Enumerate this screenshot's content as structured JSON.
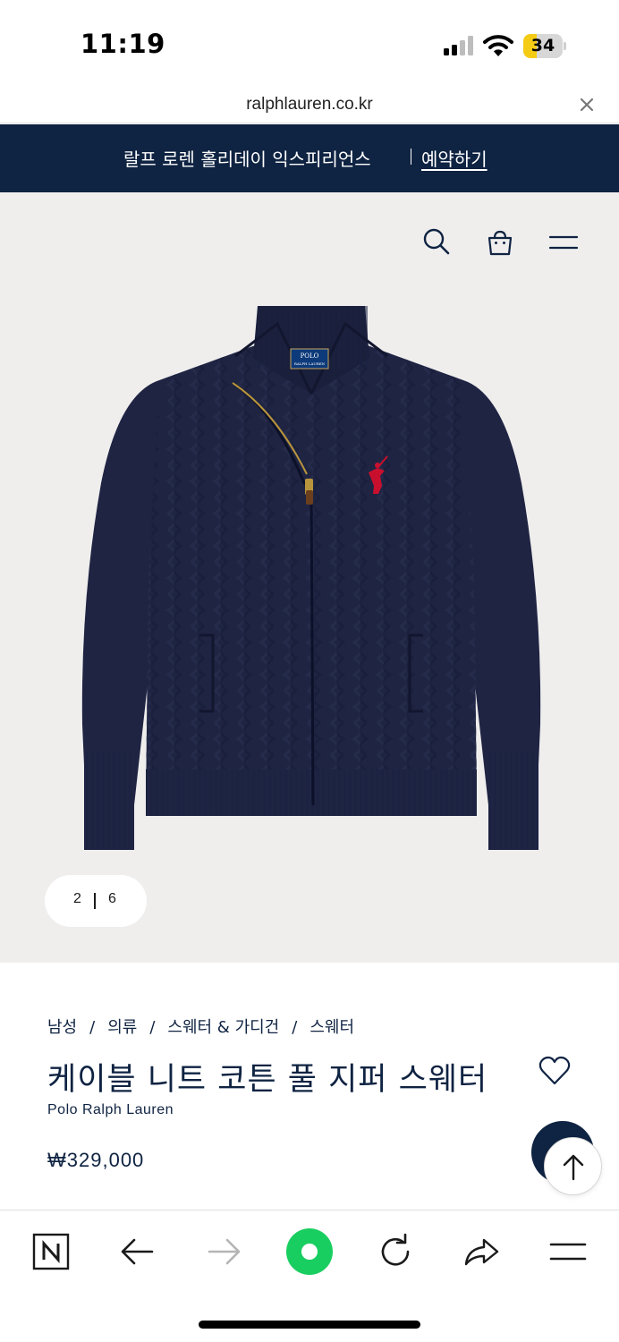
{
  "status_bar": {
    "time": "11:19",
    "battery_level": "34",
    "battery_fraction": 0.34,
    "battery_color": "#f5cc15"
  },
  "browser": {
    "url": "ralphlauren.co.kr"
  },
  "promo": {
    "text": "랄프 로렌 홀리데이 익스피리언스",
    "link_label": "예약하기",
    "background": "#0f2342"
  },
  "header_icons": [
    "search-icon",
    "shopping-bag-icon",
    "menu-icon"
  ],
  "gallery": {
    "current": "2",
    "total": "6",
    "background": "#efeeed"
  },
  "product": {
    "breadcrumb": [
      "남성",
      "의류",
      "스웨터 & 가디건",
      "스웨터"
    ],
    "title": "케이블 니트 코튼 풀 지퍼 스웨터",
    "brand": "Polo Ralph Lauren",
    "price": "₩329,000",
    "label_top": "POLO",
    "label_bottom": "RALPH LAUREN"
  },
  "toolbar": [
    "naver-icon",
    "back-arrow-icon",
    "forward-arrow-icon",
    "green-dot-icon",
    "refresh-icon",
    "share-icon",
    "menu-icon"
  ],
  "colors": {
    "navy": "#0f2342",
    "accent_green": "#19ce60",
    "logo_red": "#c8102e"
  }
}
